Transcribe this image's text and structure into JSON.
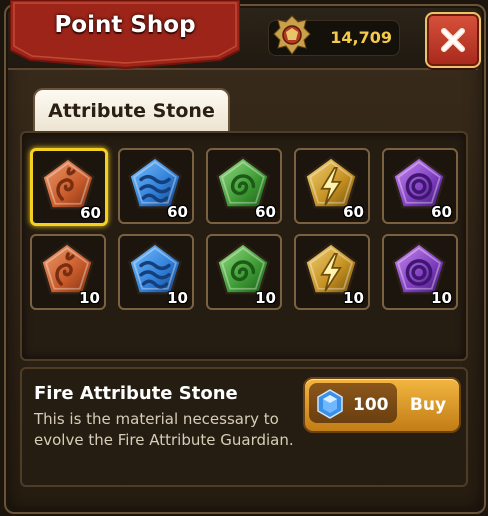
{
  "header": {
    "title": "Point Shop",
    "currency": {
      "icon": "crest-medal-icon",
      "value": "14,709"
    },
    "close_icon": "close-x-icon"
  },
  "tabs": [
    {
      "label": "Attribute Stone",
      "active": true
    }
  ],
  "items": [
    {
      "name": "fire-stone",
      "element": "fire",
      "qty": "60",
      "selected": true
    },
    {
      "name": "water-stone",
      "element": "water",
      "qty": "60"
    },
    {
      "name": "wind-stone",
      "element": "wind",
      "qty": "60"
    },
    {
      "name": "light-stone",
      "element": "light",
      "qty": "60"
    },
    {
      "name": "dark-stone",
      "element": "dark",
      "qty": "60"
    },
    {
      "name": "fire-stone",
      "element": "fire",
      "qty": "10"
    },
    {
      "name": "water-stone",
      "element": "water",
      "qty": "10"
    },
    {
      "name": "wind-stone",
      "element": "wind",
      "qty": "10"
    },
    {
      "name": "light-stone",
      "element": "light",
      "qty": "10"
    },
    {
      "name": "dark-stone",
      "element": "dark",
      "qty": "10"
    }
  ],
  "detail": {
    "name": "Fire Attribute Stone",
    "description": "This is the material necessary to evolve the Fire Attribute Guardian."
  },
  "buy": {
    "price_icon": "gem-icon",
    "price": "100",
    "label": "Buy"
  },
  "colors": {
    "fire": "#e07a45",
    "water": "#3f8fe0",
    "wind": "#54b84a",
    "light": "#e2b53a",
    "dark": "#9b52d6",
    "selected": "#f5d020"
  }
}
